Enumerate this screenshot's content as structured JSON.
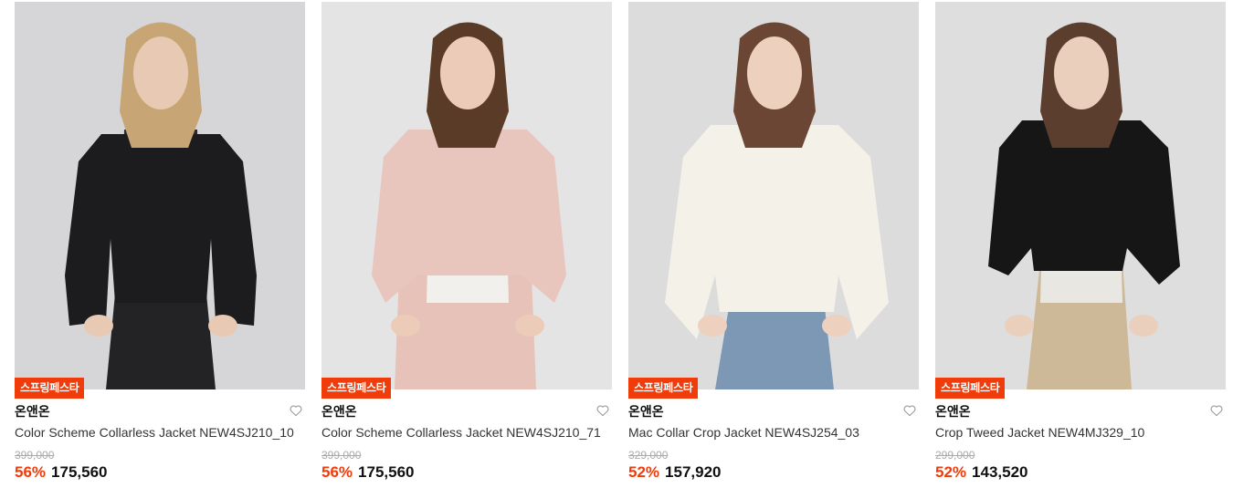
{
  "products": [
    {
      "badge": "스프링페스타",
      "brand": "온앤온",
      "name": "Color Scheme Collarless Jacket NEW4SJ210_10",
      "original_price": "399,000",
      "discount": "56%",
      "price": "175,560",
      "colors": {
        "bg": "#d6d6d8",
        "jacket": "#1c1c1e",
        "inner": "#2a2a2c",
        "hair": "#c8a574",
        "skin": "#e8c9b3",
        "bottom": "#232325"
      }
    },
    {
      "badge": "스프링페스타",
      "brand": "온앤온",
      "name": "Color Scheme Collarless Jacket NEW4SJ210_71",
      "original_price": "399,000",
      "discount": "56%",
      "price": "175,560",
      "colors": {
        "bg": "#e4e4e4",
        "jacket": "#e9c6bd",
        "inner": "#f2f0ec",
        "hair": "#5a3b28",
        "skin": "#ecccb9",
        "bottom": "#e6c2b8"
      }
    },
    {
      "badge": "스프링페스타",
      "brand": "온앤온",
      "name": "Mac Collar Crop Jacket NEW4SJ254_03",
      "original_price": "329,000",
      "discount": "52%",
      "price": "157,920",
      "colors": {
        "bg": "#dcdcdc",
        "jacket": "#f4f1e9",
        "inner": "#b8b373",
        "hair": "#6b4634",
        "skin": "#edd0bd",
        "bottom": "#7c98b5"
      }
    },
    {
      "badge": "스프링페스타",
      "brand": "온앤온",
      "name": "Crop Tweed Jacket NEW4MJ329_10",
      "original_price": "299,000",
      "discount": "52%",
      "price": "143,520",
      "colors": {
        "bg": "#dedede",
        "jacket": "#161617",
        "inner": "#e9e7e2",
        "hair": "#5c3e2e",
        "skin": "#ebcfbd",
        "bottom": "#cdb897"
      }
    }
  ],
  "icons": {
    "wishlist": "heart-outline-icon"
  }
}
